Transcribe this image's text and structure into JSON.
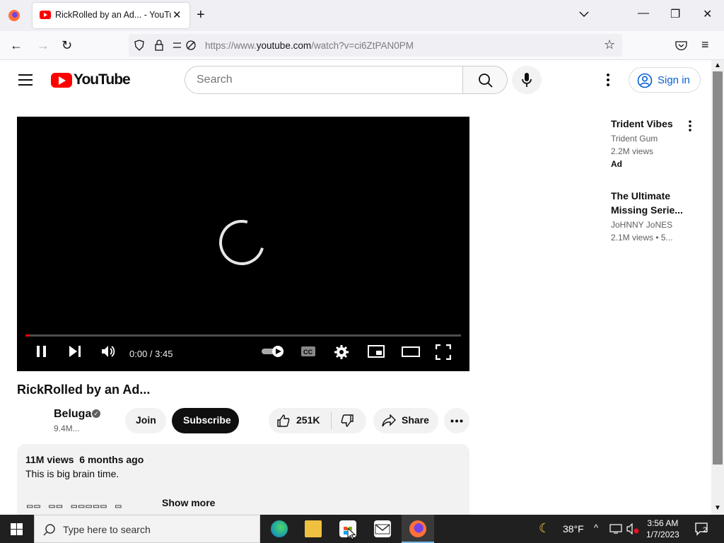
{
  "browser": {
    "tab_title": "RickRolled by an Ad... - YouTube",
    "url_prefix": "https://www.",
    "url_domain": "youtube.com",
    "url_path": "/watch?v=ci6ZtPAN0PM"
  },
  "youtube": {
    "logo_text": "YouTube",
    "search_placeholder": "Search",
    "signin_label": "Sign in"
  },
  "player": {
    "time": "0:00 / 3:45",
    "progress_fraction": 0.01
  },
  "video": {
    "title": "RickRolled by an Ad...",
    "channel": "Beluga",
    "subscribers": "9.4M...",
    "join_label": "Join",
    "subscribe_label": "Subscribe",
    "likes": "251K",
    "share_label": "Share",
    "views": "11M views",
    "age": "6 months ago",
    "description": "This is big brain time.",
    "description_boxes": "▭▭ ▭▭ ▭▭▭▭▭ ▭",
    "show_more": "Show more"
  },
  "recommendations": [
    {
      "title": "Trident Vibes",
      "channel": "Trident Gum",
      "meta": "2.2M views",
      "badge": "Ad"
    },
    {
      "title": "The Ultimate Missing Serie...",
      "channel": "JoHNNY JoNES",
      "meta": "2.1M views  • 5..."
    }
  ],
  "taskbar": {
    "search_placeholder": "Type here to search",
    "weather": "38°F",
    "time": "3:56 AM",
    "date": "1/7/2023",
    "notifications": "2"
  }
}
